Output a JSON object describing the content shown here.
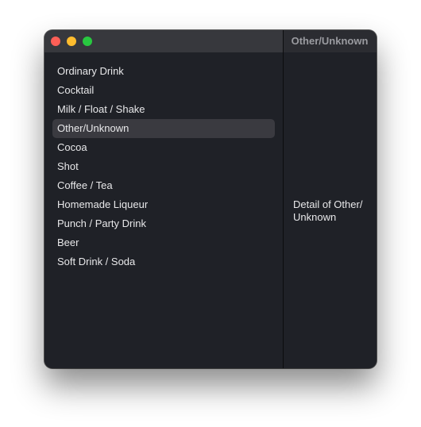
{
  "window": {
    "detail_title": "Other/Unknown"
  },
  "sidebar": {
    "items": [
      {
        "label": "Ordinary Drink"
      },
      {
        "label": "Cocktail"
      },
      {
        "label": "Milk / Float / Shake"
      },
      {
        "label": "Other/Unknown",
        "selected": true
      },
      {
        "label": "Cocoa"
      },
      {
        "label": "Shot"
      },
      {
        "label": "Coffee / Tea"
      },
      {
        "label": "Homemade Liqueur"
      },
      {
        "label": "Punch / Party Drink"
      },
      {
        "label": "Beer"
      },
      {
        "label": "Soft Drink / Soda"
      }
    ]
  },
  "detail": {
    "text": "Detail of Other/\nUnknown"
  },
  "colors": {
    "close": "#fe5f57",
    "minimize": "#febc2e",
    "zoom": "#28c840",
    "selection": "#3a3a40"
  }
}
